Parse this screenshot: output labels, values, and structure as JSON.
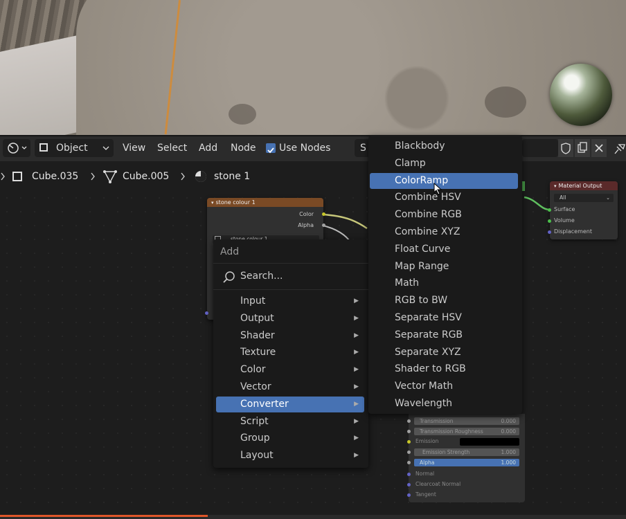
{
  "header": {
    "mode_label": "Object",
    "menus": [
      "View",
      "Select",
      "Add",
      "Node"
    ],
    "use_nodes_label": "Use Nodes",
    "slot_label": "S"
  },
  "breadcrumb": {
    "object": "Cube.035",
    "mesh": "Cube.005",
    "material": "stone 1"
  },
  "nodes": {
    "stone_colour": {
      "title": "stone colour 1",
      "outputs": [
        "Color",
        "Alpha"
      ],
      "image_name": "stone colour 1"
    },
    "material_output": {
      "title": "Material Output",
      "target": "All",
      "inputs": [
        "Surface",
        "Volume",
        "Displacement"
      ]
    }
  },
  "add_menu": {
    "title": "Add",
    "search_label": "Search...",
    "items": [
      {
        "label": "Input"
      },
      {
        "label": "Output"
      },
      {
        "label": "Shader"
      },
      {
        "label": "Texture"
      },
      {
        "label": "Color"
      },
      {
        "label": "Vector"
      },
      {
        "label": "Converter"
      },
      {
        "label": "Script"
      },
      {
        "label": "Group"
      },
      {
        "label": "Layout"
      }
    ],
    "active": "Converter"
  },
  "converter_menu": {
    "items": [
      "Blackbody",
      "Clamp",
      "ColorRamp",
      "Combine HSV",
      "Combine RGB",
      "Combine XYZ",
      "Float Curve",
      "Map Range",
      "Math",
      "RGB to BW",
      "Separate HSV",
      "Separate RGB",
      "Separate XYZ",
      "Shader to RGB",
      "Vector Math",
      "Wavelength"
    ],
    "active": "ColorRamp"
  },
  "bsdf_fields": {
    "transmission": {
      "label": "Transmission",
      "value": "0.000"
    },
    "transmission_roughness": {
      "label": "Transmission Roughness",
      "value": "0.000"
    },
    "emission": {
      "label": "Emission"
    },
    "emission_strength": {
      "label": "Emission Strength",
      "value": "1.000"
    },
    "alpha": {
      "label": "Alpha",
      "value": "1.000"
    },
    "normal": {
      "label": "Normal"
    },
    "clearcoat_normal": {
      "label": "Clearcoat Normal"
    },
    "tangent": {
      "label": "Tangent"
    }
  },
  "colors": {
    "accent": "#4772b3",
    "texture_header": "#7a4a25",
    "output_header": "#5a2a2a"
  }
}
